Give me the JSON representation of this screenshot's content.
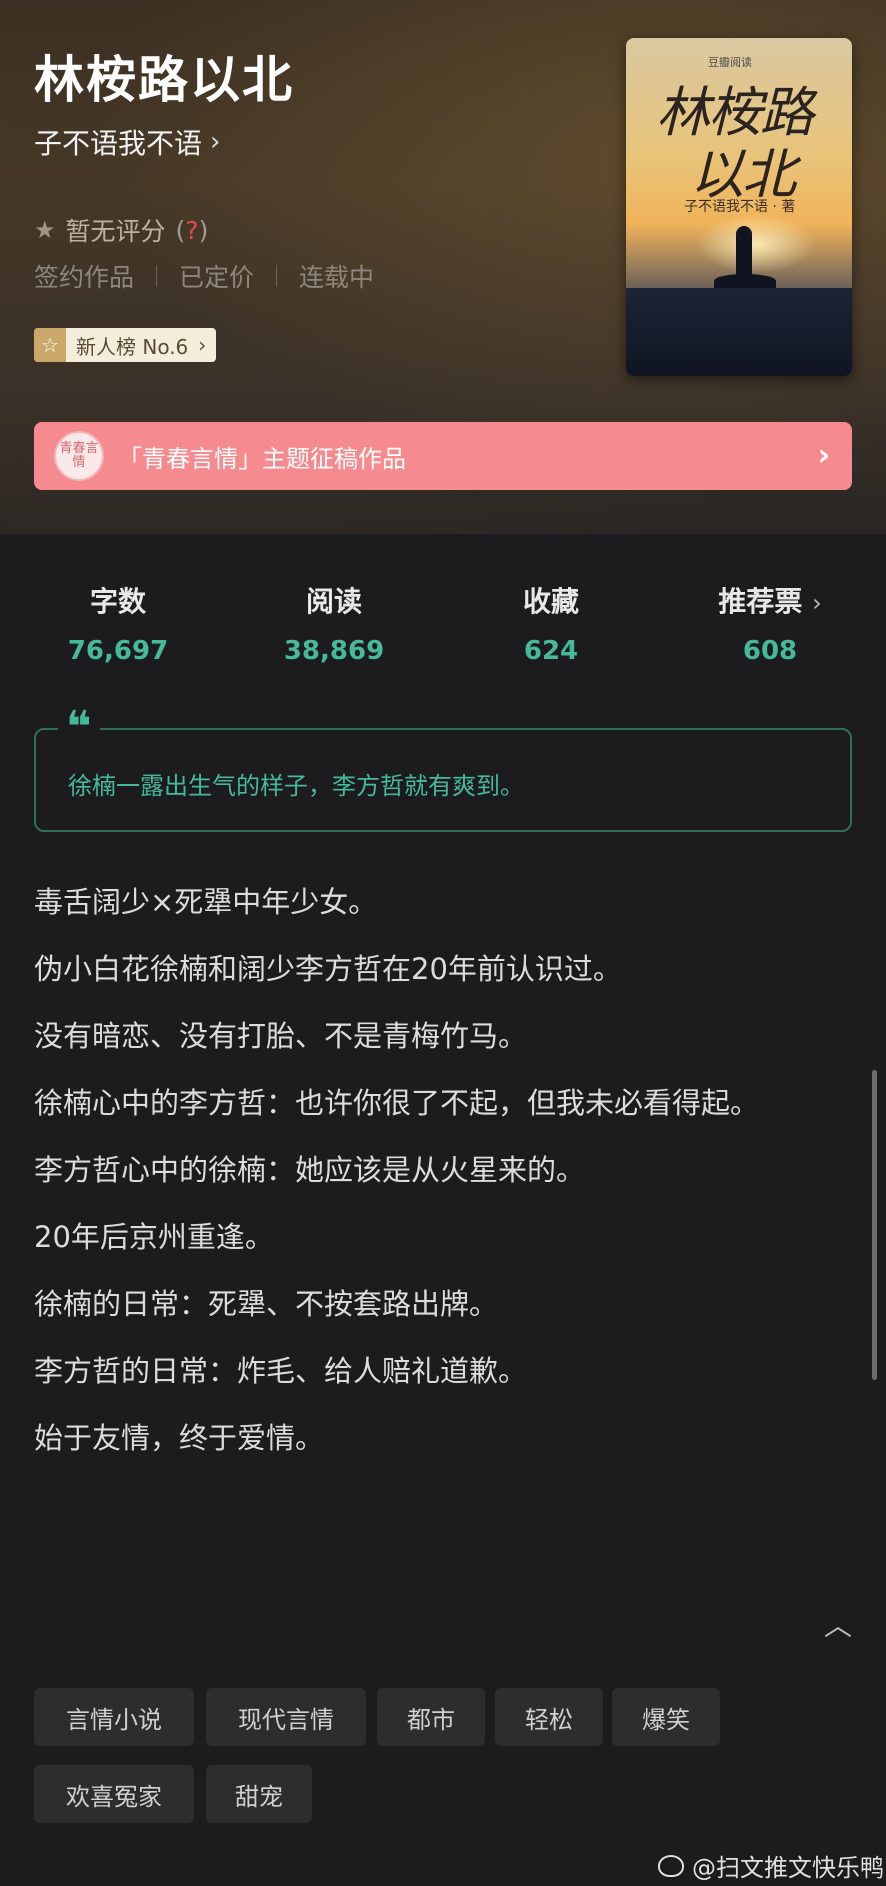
{
  "book": {
    "title": "林桉路以北",
    "author": "子不语我不语",
    "author_chevron": "›",
    "rating_star_icon": "★",
    "rating": "暂无评分",
    "rating_help_open": "(",
    "rating_help": "?",
    "rating_help_close": ")",
    "meta": [
      "签约作品",
      "已定价",
      "连载中"
    ],
    "rank_badge": "新人榜 No.6",
    "rank_badge_icon": "☆",
    "rank_chevron": "›"
  },
  "cover": {
    "brand": "豆瓣阅读",
    "title_line1": "林桉路",
    "title_line2": "以北",
    "author_line": "子不语我不语 · 著"
  },
  "promo": {
    "seal_text": "青春言情",
    "text": "「青春言情」主题征稿作品",
    "chevron": "›"
  },
  "stats": [
    {
      "label": "字数",
      "value": "76,697"
    },
    {
      "label": "阅读",
      "value": "38,869"
    },
    {
      "label": "收藏",
      "value": "624"
    },
    {
      "label": "推荐票",
      "value": "608",
      "chevron": "›"
    }
  ],
  "quote": {
    "mark": "❝",
    "text": "徐楠一露出生气的样子，李方哲就有爽到。"
  },
  "synopsis": [
    "毒舌阔少×死犟中年少女。",
    "伪小白花徐楠和阔少李方哲在20年前认识过。",
    "没有暗恋、没有打胎、不是青梅竹马。",
    "徐楠心中的李方哲：也许你很了不起，但我未必看得起。",
    "李方哲心中的徐楠：她应该是从火星来的。",
    "20年后京州重逢。",
    "徐楠的日常：死犟、不按套路出牌。",
    "李方哲的日常：炸毛、给人赔礼道歉。",
    "始于友情，终于爱情。"
  ],
  "collapse_icon": "︿",
  "tags": [
    "言情小说",
    "现代言情",
    "都市",
    "轻松",
    "爆笑",
    "欢喜冤家",
    "甜宠"
  ],
  "watermark": "@扫文推文快乐鸭"
}
